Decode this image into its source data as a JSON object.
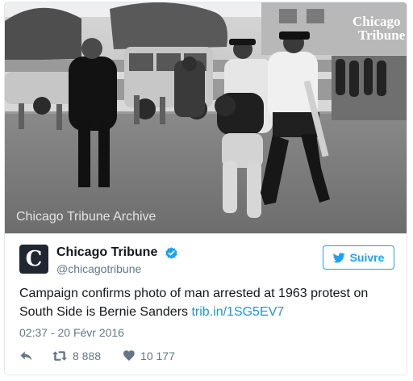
{
  "photo": {
    "watermark_title": [
      "Chicago",
      "Tribune"
    ],
    "credit": "Chicago Tribune Archive"
  },
  "account": {
    "avatar_letter": "C",
    "display_name": "Chicago Tribune",
    "handle": "@chicagotribune",
    "verified": true
  },
  "follow_button": {
    "label": "Suivre",
    "icon": "twitter-bird-icon"
  },
  "tweet": {
    "text": "Campaign confirms photo of man arrested at 1963 protest on South Side is Bernie Sanders",
    "link": "trib.in/1SG5EV7",
    "timestamp": "02:37 - 20 Févr 2016"
  },
  "actions": {
    "reply_icon": "reply-icon",
    "retweet_icon": "retweet-icon",
    "retweet_count": "8 888",
    "like_icon": "heart-icon",
    "like_count": "10 177"
  },
  "colors": {
    "accent": "#1da1f2",
    "link": "#1b95e0",
    "text": "#14171a",
    "muted": "#657786",
    "border": "#e1e8ed"
  }
}
